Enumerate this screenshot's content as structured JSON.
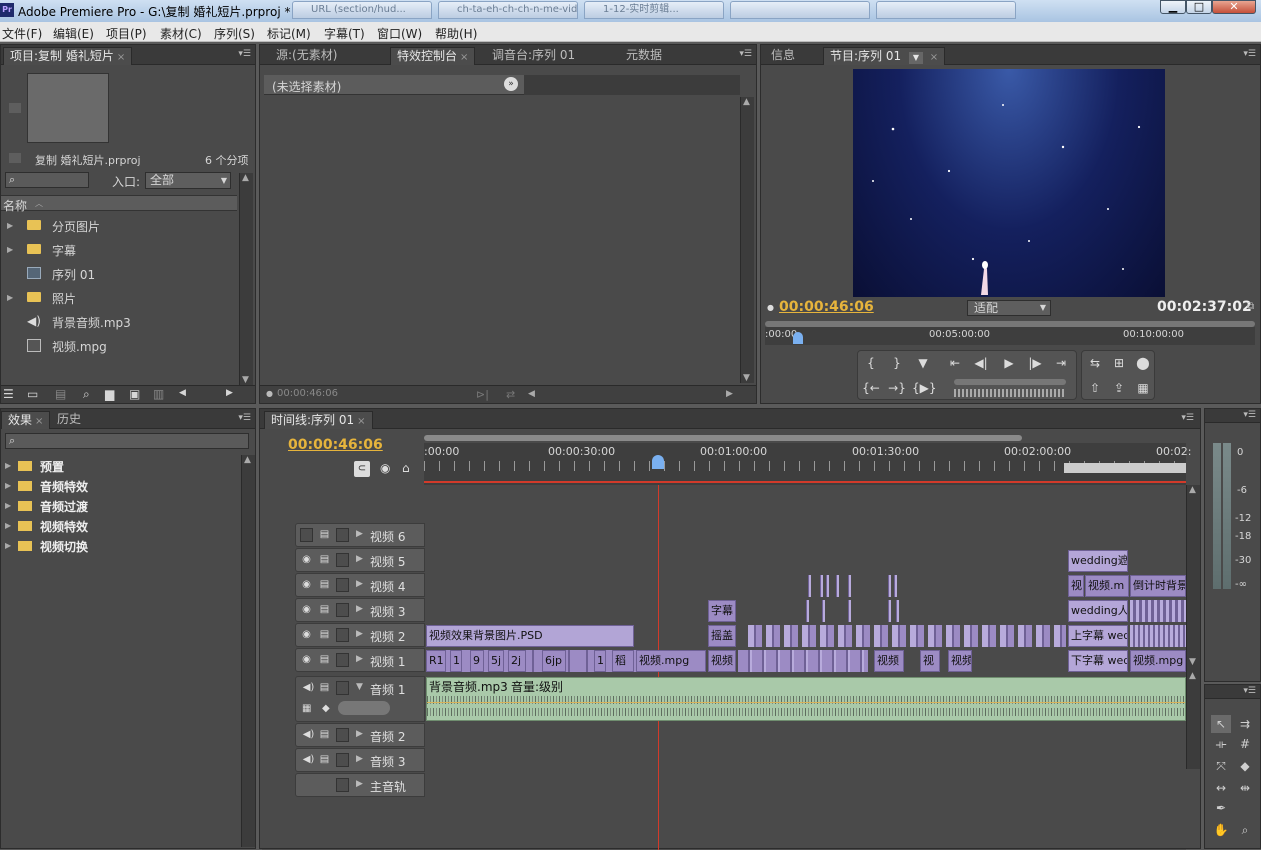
{
  "window": {
    "title": "Adobe Premiere Pro - G:\\复制 婚礼短片.prproj *",
    "browser_tabs": [
      "URL (section/hud...",
      "ch-ta-eh-ch-ch-n-me-vid...",
      "1-12-实时剪辑...",
      "",
      ""
    ],
    "controls": {
      "minimize": "▁",
      "maximize": "□",
      "close": "✕"
    }
  },
  "menu": [
    "文件(F)",
    "编辑(E)",
    "项目(P)",
    "素材(C)",
    "序列(S)",
    "标记(M)",
    "字幕(T)",
    "窗口(W)",
    "帮助(H)"
  ],
  "project_panel": {
    "tab": "项目:复制 婚礼短片",
    "file_name": "复制 婚礼短片.prproj",
    "item_count": "6 个分项",
    "in_label": "入口:",
    "in_value": "全部",
    "column_header": "名称",
    "items": [
      {
        "label": "分页图片",
        "icon": "folder-icon",
        "expandable": true
      },
      {
        "label": "字幕",
        "icon": "folder-icon",
        "expandable": true
      },
      {
        "label": "序列 01",
        "icon": "sequence-icon",
        "expandable": false
      },
      {
        "label": "照片",
        "icon": "folder-icon",
        "expandable": true
      },
      {
        "label": "背景音频.mp3",
        "icon": "audio-file-icon",
        "expandable": false
      },
      {
        "label": "视频.mpg",
        "icon": "video-file-icon",
        "expandable": false
      }
    ]
  },
  "effects_control_panel": {
    "tabs": [
      "源:(无素材)",
      "特效控制台",
      "调音台:序列 01",
      "元数据"
    ],
    "active_tab": "特效控制台",
    "no_clip_label": "(未选择素材)",
    "timecode": "00:00:46:06"
  },
  "program_monitor": {
    "tabs": [
      "信息",
      "节目:序列 01"
    ],
    "current_time": "00:00:46:06",
    "fit": "适配",
    "duration": "00:02:37:02",
    "ruler_labels": [
      ":00:00",
      "00:05:00:00",
      "00:10:00:00"
    ]
  },
  "effects_panel": {
    "tabs": [
      "效果",
      "历史"
    ],
    "items": [
      "预置",
      "音频特效",
      "音频过渡",
      "视频特效",
      "视频切换"
    ]
  },
  "timeline": {
    "tab": "时间线:序列 01",
    "current_time": "00:00:46:06",
    "ruler_labels": [
      ":00:00",
      "00:00:30:00",
      "00:01:00:00",
      "00:01:30:00",
      "00:02:00:00",
      "00:02:"
    ],
    "video_tracks": [
      "视频 6",
      "视频 5",
      "视频 4",
      "视频 3",
      "视频 2",
      "视频 1"
    ],
    "audio_tracks": [
      "音频 1",
      "音频 2",
      "音频 3",
      "主音轨"
    ],
    "audio_clip_label": "背景音频.mp3",
    "audio_clip_volume": "音量:级别",
    "clips": {
      "v5": [
        "wedding遮"
      ],
      "v4": [
        "视",
        "视频.m",
        "倒计时背景"
      ],
      "v3": [
        "字幕",
        "wedding人"
      ],
      "v2": [
        "视频效果背景图片.PSD",
        "摇盖",
        "上字幕 wed"
      ],
      "v1": [
        "R1",
        "1",
        "9",
        "5j",
        "2j",
        "6jp",
        "1",
        "稻",
        "视频.mpg",
        "视频",
        "视频",
        "视",
        "视频",
        "下字幕 wed",
        "视频.mpg"
      ]
    }
  },
  "audio_meter": {
    "labels": [
      "0",
      "-6",
      "-12",
      "-18",
      "-30",
      "-∞"
    ]
  },
  "colors": {
    "timecode": "#e6b43c",
    "video_clip": "#9c8bc4",
    "audio_clip": "#a9c9a9",
    "playhead": "#d23a2a"
  }
}
